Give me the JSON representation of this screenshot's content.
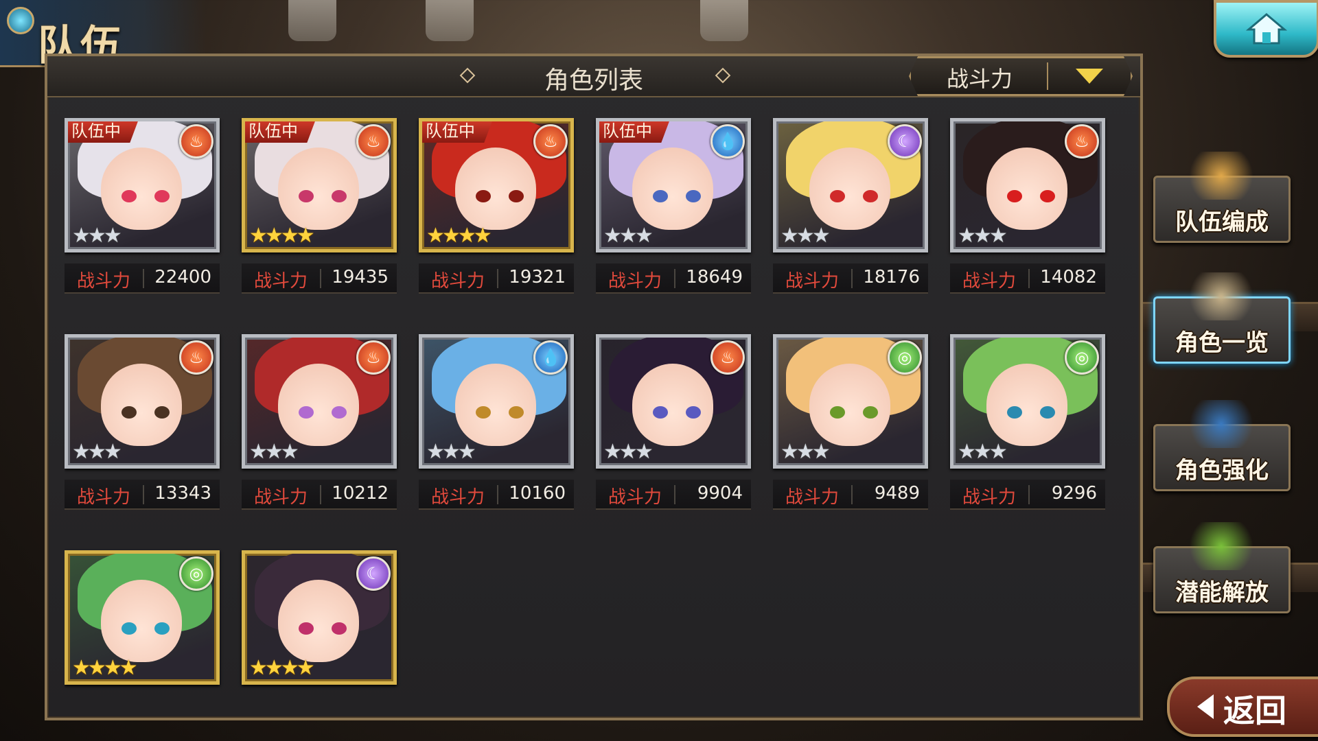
{
  "header": {
    "title": "队伍",
    "home_icon": "home-icon"
  },
  "panel": {
    "title": "角色列表",
    "sort": {
      "selected": "战斗力",
      "icon": "dropdown-arrow-icon"
    }
  },
  "power_label": "战斗力",
  "characters": [
    {
      "in_team": true,
      "team_badge": "队伍中",
      "element": "fire",
      "stars": 3,
      "star_color": "silver",
      "frame": "silver",
      "power": "22400",
      "hair": "#e6e2ea",
      "eye": "#e0385a"
    },
    {
      "in_team": true,
      "team_badge": "队伍中",
      "element": "fire",
      "stars": 4,
      "star_color": "gold",
      "frame": "gold",
      "power": "19435",
      "hair": "#e9dde0",
      "eye": "#c8386a"
    },
    {
      "in_team": true,
      "team_badge": "队伍中",
      "element": "fire",
      "stars": 4,
      "star_color": "gold",
      "frame": "gold",
      "power": "19321",
      "hair": "#c92a1e",
      "eye": "#8a1a12"
    },
    {
      "in_team": true,
      "team_badge": "队伍中",
      "element": "water",
      "stars": 3,
      "star_color": "silver",
      "frame": "silver",
      "power": "18649",
      "hair": "#c9b8e6",
      "eye": "#4a68c0"
    },
    {
      "in_team": false,
      "team_badge": "",
      "element": "dark",
      "stars": 3,
      "star_color": "silver",
      "frame": "silver",
      "power": "18176",
      "hair": "#f1d36a",
      "eye": "#d02a2a"
    },
    {
      "in_team": false,
      "team_badge": "",
      "element": "fire",
      "stars": 3,
      "star_color": "silver",
      "frame": "silver",
      "power": "14082",
      "hair": "#2a1c1c",
      "eye": "#d81e1e"
    },
    {
      "in_team": false,
      "team_badge": "",
      "element": "fire",
      "stars": 3,
      "star_color": "silver",
      "frame": "silver",
      "power": "13343",
      "hair": "#6a4a32",
      "eye": "#4a3222"
    },
    {
      "in_team": false,
      "team_badge": "",
      "element": "fire",
      "stars": 3,
      "star_color": "silver",
      "frame": "silver",
      "power": "10212",
      "hair": "#b02a2a",
      "eye": "#b06ad0"
    },
    {
      "in_team": false,
      "team_badge": "",
      "element": "water",
      "stars": 3,
      "star_color": "silver",
      "frame": "silver",
      "power": "10160",
      "hair": "#6ab0e6",
      "eye": "#c08a2a"
    },
    {
      "in_team": false,
      "team_badge": "",
      "element": "fire",
      "stars": 3,
      "star_color": "silver",
      "frame": "silver",
      "power": "9904",
      "hair": "#2a1c34",
      "eye": "#5a5ac0"
    },
    {
      "in_team": false,
      "team_badge": "",
      "element": "wind",
      "stars": 3,
      "star_color": "silver",
      "frame": "silver",
      "power": "9489",
      "hair": "#f2c07a",
      "eye": "#6a9a2a"
    },
    {
      "in_team": false,
      "team_badge": "",
      "element": "wind",
      "stars": 3,
      "star_color": "silver",
      "frame": "silver",
      "power": "9296",
      "hair": "#7ac05a",
      "eye": "#2a8ab0"
    },
    {
      "in_team": false,
      "team_badge": "",
      "element": "wind",
      "stars": 4,
      "star_color": "gold",
      "frame": "gold",
      "power": "",
      "hair": "#5ab05a",
      "eye": "#2aa0c0"
    },
    {
      "in_team": false,
      "team_badge": "",
      "element": "dark",
      "stars": 4,
      "star_color": "gold",
      "frame": "gold",
      "power": "",
      "hair": "#3a2a3a",
      "eye": "#c0306a"
    }
  ],
  "side_menu": [
    {
      "label": "队伍编成",
      "active": false,
      "icon": "team-formation-icon"
    },
    {
      "label": "角色一览",
      "active": true,
      "icon": "character-book-icon"
    },
    {
      "label": "角色强化",
      "active": false,
      "icon": "enhance-icon"
    },
    {
      "label": "潜能解放",
      "active": false,
      "icon": "potential-orb-icon"
    }
  ],
  "back_button": {
    "label": "返回",
    "icon": "back-arrow-icon"
  },
  "element_icons": {
    "fire": "fire-icon",
    "water": "water-icon",
    "dark": "moon-icon",
    "wind": "wind-icon"
  }
}
